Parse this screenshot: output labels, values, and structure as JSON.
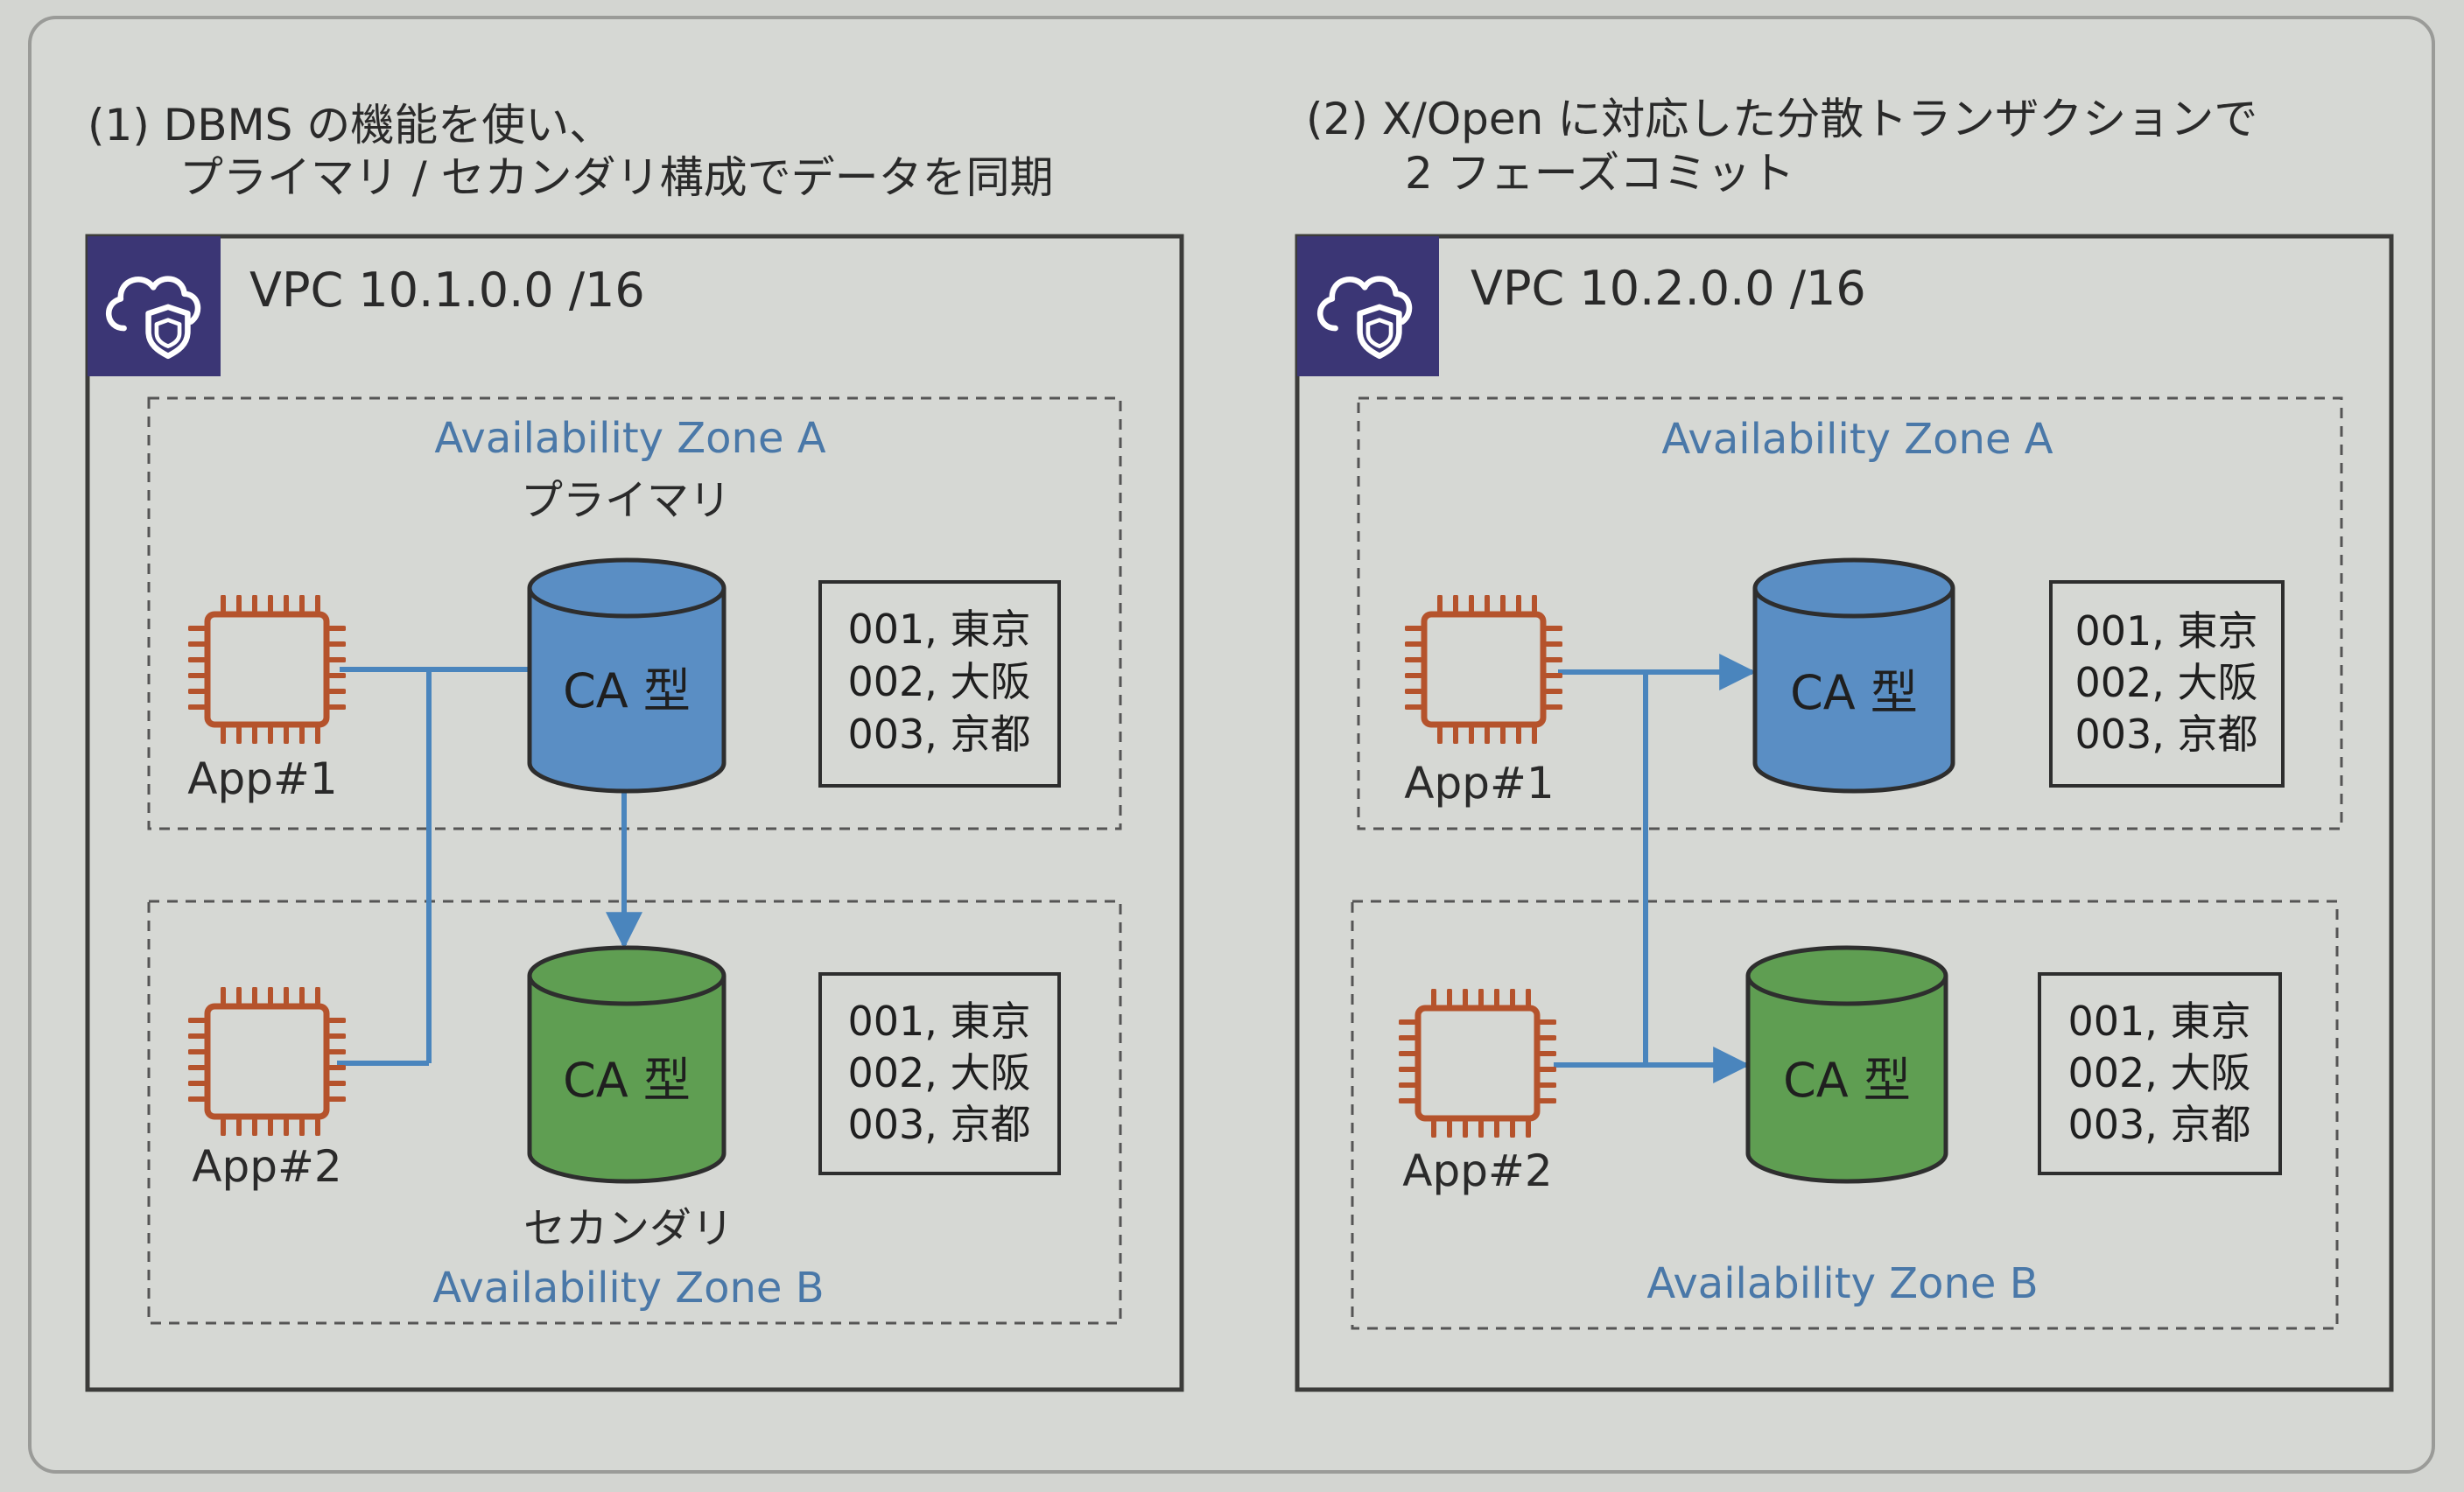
{
  "colors": {
    "background": "#d3d5d1",
    "frame": "#9a9b98",
    "box_border": "#3c3c3a",
    "vpc_badge": "#3b3675",
    "zone_text": "#4a78a8",
    "line_blue": "#4a85bd",
    "chip": "#b5532c",
    "db_primary_fill": "#5a8ec4",
    "db_secondary_fill": "#5f9e52",
    "text_dark": "#2a2a2a"
  },
  "left": {
    "caption_line1": "(1) DBMS の機能を使い、",
    "caption_line2": "プライマリ / セカンダリ構成でデータを同期",
    "vpc_label": "VPC 10.1.0.0 /16",
    "vpc_icon": "cloud-shield-icon",
    "zone_a_label": "Availability Zone A",
    "zone_b_label": "Availability Zone B",
    "primary_label": "プライマリ",
    "secondary_label": "セカンダリ",
    "app1_label": "App#1",
    "app2_label": "App#2",
    "db_top_label": "CA 型",
    "db_bottom_label": "CA 型",
    "table_top": [
      "001, 東京",
      "002, 大阪",
      "003, 京都"
    ],
    "table_bottom": [
      "001, 東京",
      "002, 大阪",
      "003, 京都"
    ]
  },
  "right": {
    "caption_line1": "(2) X/Open に対応した分散トランザクションで",
    "caption_line2": "2 フェーズコミット",
    "vpc_label": "VPC 10.2.0.0 /16",
    "vpc_icon": "cloud-shield-icon",
    "zone_a_label": "Availability Zone A",
    "zone_b_label": "Availability Zone B",
    "app1_label": "App#1",
    "app2_label": "App#2",
    "db_top_label": "CA 型",
    "db_bottom_label": "CA 型",
    "table_top": [
      "001, 東京",
      "002, 大阪",
      "003, 京都"
    ],
    "table_bottom": [
      "001, 東京",
      "002, 大阪",
      "003, 京都"
    ]
  }
}
